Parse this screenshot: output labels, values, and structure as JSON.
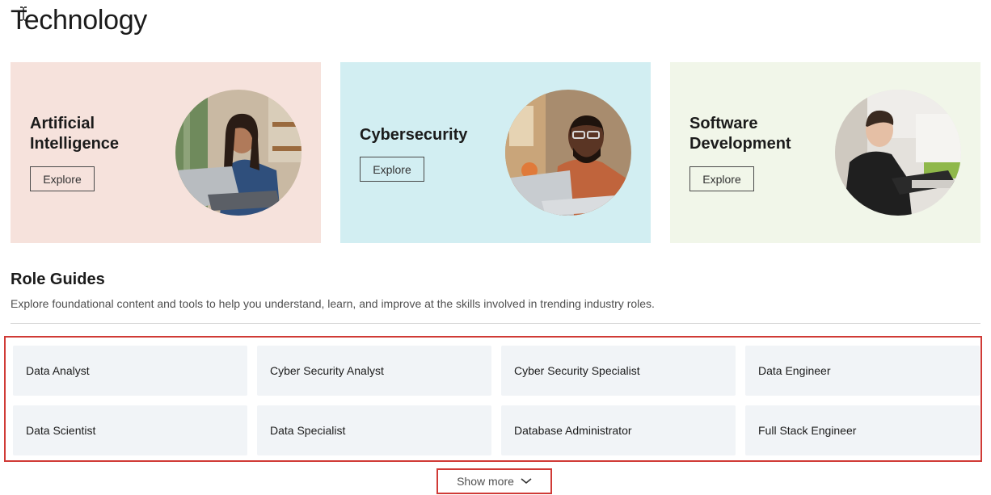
{
  "page": {
    "title": "Technology"
  },
  "cards": [
    {
      "title": "Artificial Intelligence",
      "button": "Explore",
      "bg": "#f6e2dc",
      "icon": "person-with-laptop-photo"
    },
    {
      "title": "Cybersecurity",
      "button": "Explore",
      "bg": "#d2eef2",
      "icon": "person-with-laptop-photo"
    },
    {
      "title": "Software Development",
      "button": "Explore",
      "bg": "#f1f6e9",
      "icon": "person-at-desk-photo"
    }
  ],
  "role_guides": {
    "title": "Role Guides",
    "description": "Explore foundational content and tools to help you understand, learn, and improve at the skills involved in trending industry roles.",
    "roles": [
      "Data Analyst",
      "Cyber Security Analyst",
      "Cyber Security Specialist",
      "Data Engineer",
      "Data Scientist",
      "Data Specialist",
      "Database Administrator",
      "Full Stack Engineer"
    ],
    "show_more": "Show more"
  },
  "colors": {
    "highlight": "#d03a36",
    "tile_bg": "#f1f4f7"
  }
}
